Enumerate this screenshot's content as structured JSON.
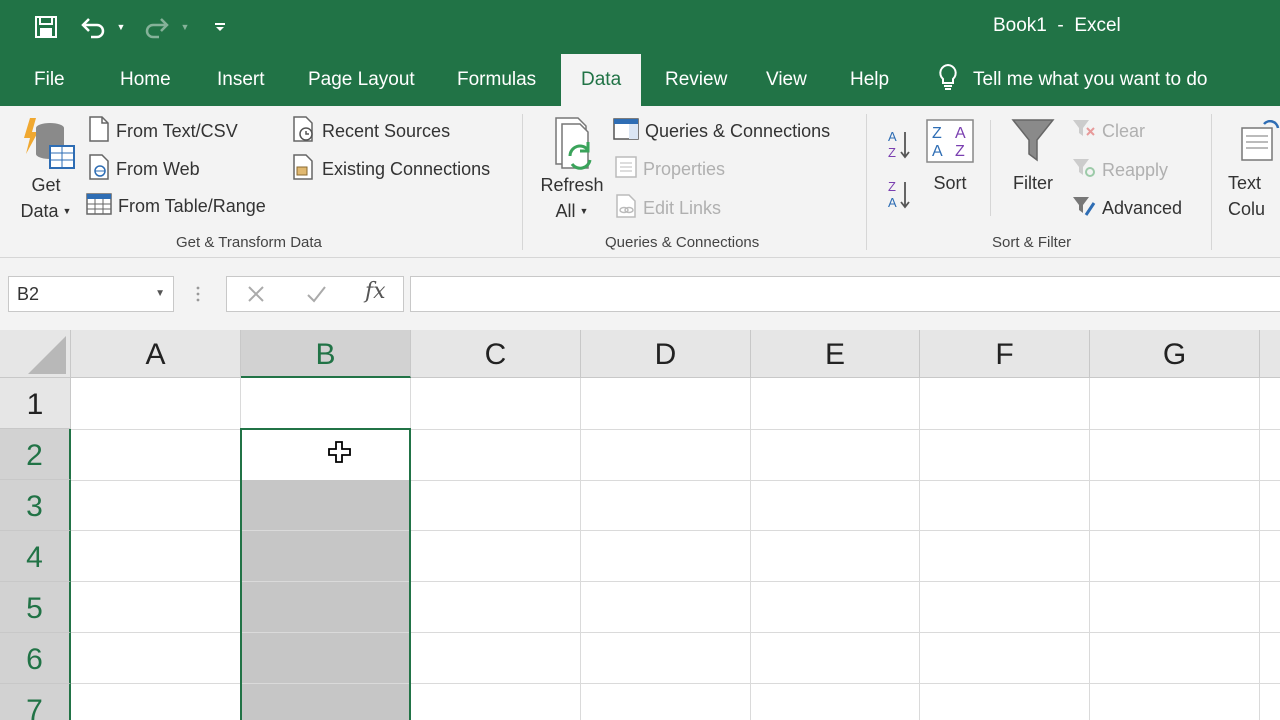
{
  "window": {
    "title": "Book1  -  Excel"
  },
  "tabs": [
    {
      "label": "File",
      "active": false
    },
    {
      "label": "Home",
      "active": false
    },
    {
      "label": "Insert",
      "active": false
    },
    {
      "label": "Page Layout",
      "active": false
    },
    {
      "label": "Formulas",
      "active": false
    },
    {
      "label": "Data",
      "active": true
    },
    {
      "label": "Review",
      "active": false
    },
    {
      "label": "View",
      "active": false
    },
    {
      "label": "Help",
      "active": false
    }
  ],
  "tell_me": {
    "text": "Tell me what you want to do",
    "icon": "lightbulb-icon"
  },
  "ribbon": {
    "get_transform": {
      "get_data_line1": "Get",
      "get_data_line2": "Data",
      "from_text_csv": "From Text/CSV",
      "from_web": "From Web",
      "from_table_range": "From Table/Range",
      "recent_sources": "Recent Sources",
      "existing_connections": "Existing Connections",
      "group_label": "Get & Transform Data"
    },
    "queries": {
      "refresh_line1": "Refresh",
      "refresh_line2": "All",
      "queries_connections": "Queries & Connections",
      "properties": "Properties",
      "edit_links": "Edit Links",
      "group_label": "Queries & Connections"
    },
    "sort_filter": {
      "sort": "Sort",
      "filter": "Filter",
      "clear": "Clear",
      "reapply": "Reapply",
      "advanced": "Advanced",
      "group_label": "Sort & Filter"
    },
    "data_tools": {
      "text_line1": "Text",
      "text_line2": "Colu"
    }
  },
  "formula_bar": {
    "name_box": "B2",
    "formula": ""
  },
  "grid": {
    "columns": [
      "A",
      "B",
      "C",
      "D",
      "E",
      "F",
      "G"
    ],
    "rows": [
      "1",
      "2",
      "3",
      "4",
      "5",
      "6",
      "7"
    ],
    "active_cell": "B2"
  },
  "colors": {
    "accent": "#217346",
    "selection_fill": "#c6c6c6"
  }
}
